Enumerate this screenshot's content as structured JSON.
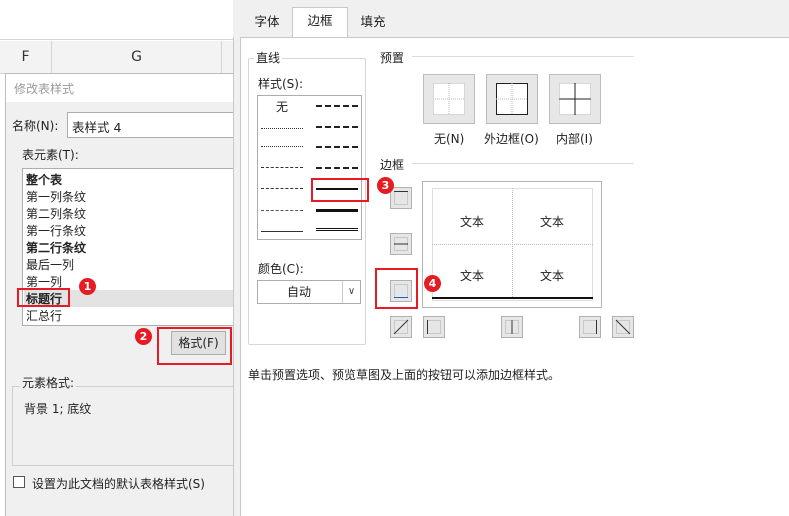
{
  "excel": {
    "columns": [
      "F",
      "G"
    ]
  },
  "modify_dialog": {
    "title": "修改表样式",
    "name_label": "名称(N):",
    "name_value": "表样式 4",
    "elements_label": "表元素(T):",
    "elements": [
      "整个表",
      "第一列条纹",
      "第二列条纹",
      "第一行条纹",
      "第二行条纹",
      "最后一列",
      "第一列",
      "标题行",
      "汇总行"
    ],
    "selected_element": "标题行",
    "format_button": "格式(F)",
    "element_format_label": "元素格式:",
    "element_format_value": "背景 1; 底纹",
    "default_checkbox_label": "设置为此文档的默认表格样式(S)"
  },
  "borders_dialog": {
    "tabs": [
      "字体",
      "边框",
      "填充"
    ],
    "active_tab": "边框",
    "line_group_label": "直线",
    "style_label": "样式(S):",
    "style_none": "无",
    "color_label": "颜色(C):",
    "color_value": "自动",
    "presets_label": "预置",
    "presets": [
      {
        "label": "无(N)",
        "icon": "preset-none-icon"
      },
      {
        "label": "外边框(O)",
        "icon": "preset-outline-icon"
      },
      {
        "label": "内部(I)",
        "icon": "preset-inside-icon"
      }
    ],
    "border_label": "边框",
    "preview_texts": [
      "文本",
      "文本",
      "文本",
      "文本"
    ],
    "hint": "单击预置选项、预览草图及上面的按钮可以添加边框样式。"
  },
  "callouts": [
    "1",
    "2",
    "3",
    "4"
  ],
  "colors": {
    "callout": "#e51c23",
    "dialog_bg": "#f0f0f0",
    "selection": "#e3e3e3"
  }
}
